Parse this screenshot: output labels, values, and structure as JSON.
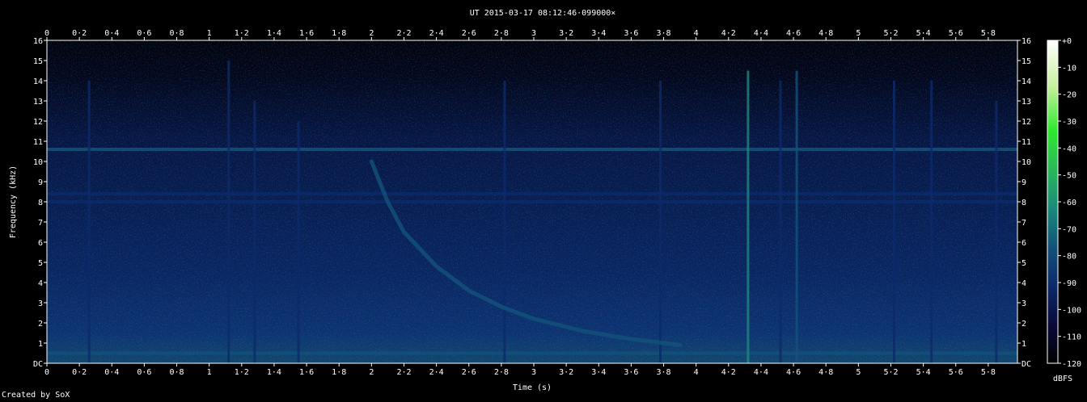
{
  "chart_data": {
    "type": "heatmap",
    "title": "UT 2015-03-17 08:12:46·099000×",
    "xlabel": "Time (s)",
    "ylabel": "Frequency (kHz)",
    "colorbar_label": "dBFS",
    "credit": "Created by SoX",
    "xlim": [
      0,
      5.98
    ],
    "ylim": [
      0,
      16
    ],
    "x_ticks": [
      0,
      0.2,
      0.4,
      0.6,
      0.8,
      1,
      1.2,
      1.4,
      1.6,
      1.8,
      2,
      2.2,
      2.4,
      2.6,
      2.8,
      3,
      3.2,
      3.4,
      3.6,
      3.8,
      4,
      4.2,
      4.4,
      4.6,
      4.8,
      5,
      5.2,
      5.4,
      5.6,
      5.8
    ],
    "x_tick_labels": [
      "0",
      "0·2",
      "0·4",
      "0·6",
      "0·8",
      "1",
      "1·2",
      "1·4",
      "1·6",
      "1·8",
      "2",
      "2·2",
      "2·4",
      "2·6",
      "2·8",
      "3",
      "3·2",
      "3·4",
      "3·6",
      "3·8",
      "4",
      "4·2",
      "4·4",
      "4·6",
      "4·8",
      "5",
      "5·2",
      "5·4",
      "5·6",
      "5·8"
    ],
    "y_ticks": [
      0,
      1,
      2,
      3,
      4,
      5,
      6,
      7,
      8,
      9,
      10,
      11,
      12,
      13,
      14,
      15,
      16
    ],
    "y_tick_labels": [
      "DC",
      "1",
      "2",
      "3",
      "4",
      "5",
      "6",
      "7",
      "8",
      "9",
      "10",
      "11",
      "12",
      "13",
      "14",
      "15",
      "16"
    ],
    "colorbar_ticks": [
      0,
      -10,
      -20,
      -30,
      -40,
      -50,
      -60,
      -70,
      -80,
      -90,
      -100,
      -110,
      -120
    ],
    "colorbar_tick_labels": [
      "+0",
      "-10",
      "-20",
      "-30",
      "-40",
      "-50",
      "-60",
      "-70",
      "-80",
      "-90",
      "-100",
      "-110",
      "-120"
    ],
    "colorscale": [
      "#000000",
      "#0a0a3a",
      "#0c2a6a",
      "#13527a",
      "#1a8a7a",
      "#2ab85a",
      "#2ee82e",
      "#c8f0a0",
      "#ffffff"
    ],
    "features": {
      "horizontal_lines_khz": [
        {
          "freq": 10.6,
          "level_dbfs": -75
        },
        {
          "freq": 8.4,
          "level_dbfs": -90
        },
        {
          "freq": 8.0,
          "level_dbfs": -88
        },
        {
          "freq": 0.5,
          "level_dbfs": -72
        }
      ],
      "whistler": {
        "points": [
          [
            2.0,
            10.0
          ],
          [
            2.1,
            8.0
          ],
          [
            2.2,
            6.5
          ],
          [
            2.4,
            4.8
          ],
          [
            2.6,
            3.6
          ],
          [
            2.8,
            2.8
          ],
          [
            3.0,
            2.2
          ],
          [
            3.3,
            1.6
          ],
          [
            3.6,
            1.2
          ],
          [
            3.9,
            0.9
          ]
        ],
        "level_dbfs": -80
      },
      "impulses": [
        {
          "t": 0.26,
          "fmax": 14,
          "level_dbfs": -92
        },
        {
          "t": 1.12,
          "fmax": 15,
          "level_dbfs": -88
        },
        {
          "t": 1.28,
          "fmax": 13,
          "level_dbfs": -94
        },
        {
          "t": 1.55,
          "fmax": 12,
          "level_dbfs": -95
        },
        {
          "t": 2.82,
          "fmax": 14,
          "level_dbfs": -85
        },
        {
          "t": 3.78,
          "fmax": 14,
          "level_dbfs": -92
        },
        {
          "t": 4.32,
          "fmax": 14.5,
          "level_dbfs": -65
        },
        {
          "t": 4.52,
          "fmax": 14,
          "level_dbfs": -85
        },
        {
          "t": 4.62,
          "fmax": 14.5,
          "level_dbfs": -80
        },
        {
          "t": 5.22,
          "fmax": 14,
          "level_dbfs": -92
        },
        {
          "t": 5.45,
          "fmax": 14,
          "level_dbfs": -92
        },
        {
          "t": 5.85,
          "fmax": 13,
          "level_dbfs": -95
        }
      ]
    }
  }
}
